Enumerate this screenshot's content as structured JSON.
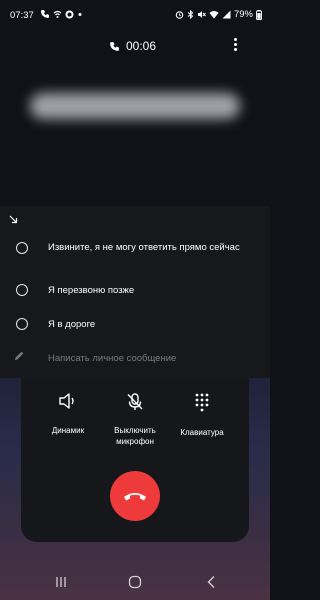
{
  "status": {
    "time": "07:37",
    "battery": "79%"
  },
  "call": {
    "timer": "00:06"
  },
  "reject_messages": {
    "options": [
      "Извините, я не могу ответить прямо сейчас",
      "Я перезвоню позже",
      "Я в дороге"
    ],
    "custom_placeholder": "Написать личное сообщение"
  },
  "controls": {
    "speaker": "Динамик",
    "mute_line1": "Выключить",
    "mute_line2": "микрофон",
    "keypad": "Клавиатура"
  },
  "colors": {
    "end_call": "#ee3a3a",
    "sheet_bg": "#17181c"
  }
}
